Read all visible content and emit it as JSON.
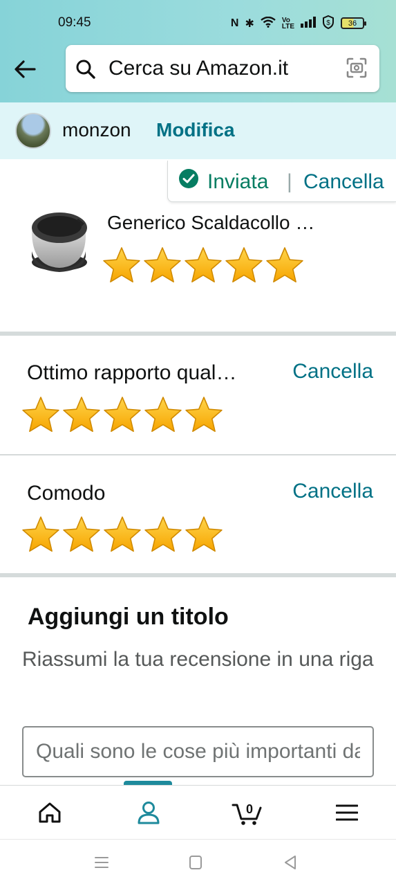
{
  "status_bar": {
    "time": "09:45",
    "battery": "36",
    "icons": [
      "nfc-icon",
      "bluetooth-icon",
      "wifi-icon",
      "volte-icon",
      "signal-icon",
      "shield-icon",
      "battery-icon"
    ]
  },
  "header": {
    "search_placeholder": "Cerca su Amazon.it",
    "accent": "#007185"
  },
  "profile": {
    "name": "monzon",
    "edit_label": "Modifica"
  },
  "review_status": {
    "sent_label": "Inviata",
    "separator": "|",
    "cancel_label": "Cancella",
    "sent_color": "#067d62"
  },
  "product": {
    "title": "Generico Scaldacollo …",
    "rating": 5,
    "max_rating": 5
  },
  "attributes": [
    {
      "label": "Ottimo rapporto qual…",
      "cancel_label": "Cancella",
      "rating": 5,
      "max_rating": 5
    },
    {
      "label": "Comodo",
      "cancel_label": "Cancella",
      "rating": 5,
      "max_rating": 5
    }
  ],
  "add_title": {
    "heading": "Aggiungi un titolo",
    "subtitle": "Riassumi la tua recensione in una riga",
    "input_placeholder": "Quali sono le cose più importanti da sapere?"
  },
  "bottom_nav": {
    "items": [
      "home-icon",
      "account-icon",
      "cart-icon",
      "menu-icon"
    ],
    "cart_count": "0",
    "active": "account-icon"
  },
  "system_nav": [
    "recent-apps-icon",
    "home-button-icon",
    "back-triangle-icon"
  ]
}
